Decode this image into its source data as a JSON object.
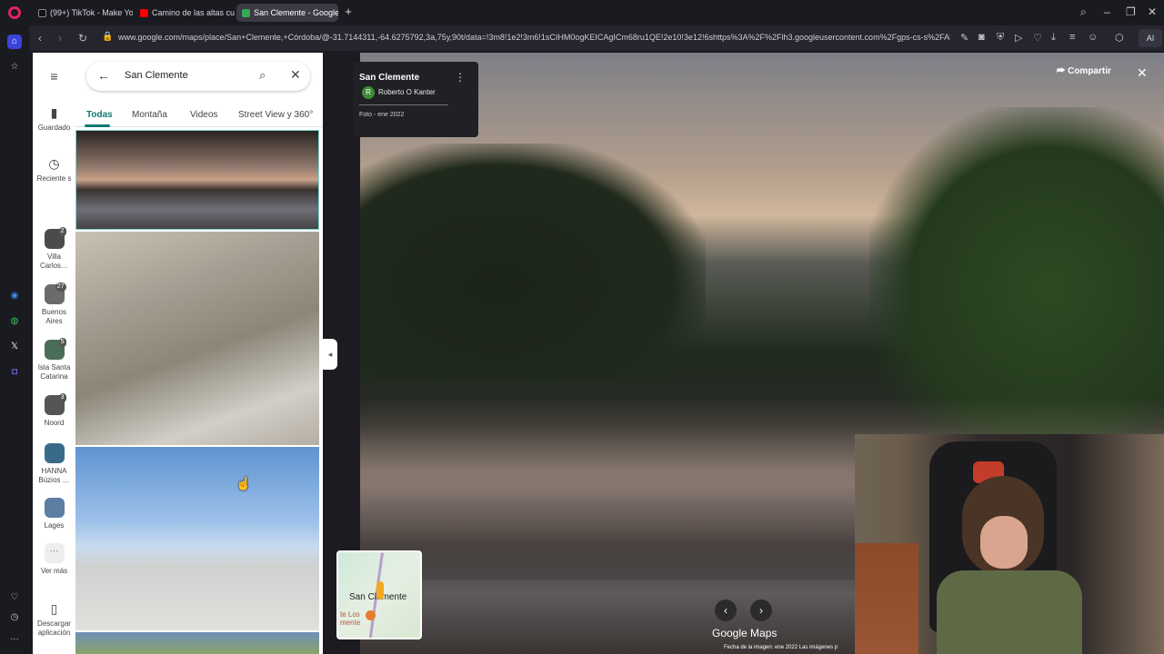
{
  "browser": {
    "tabs": [
      {
        "label": "(99+) TikTok - Make Your D",
        "color": "#111111"
      },
      {
        "label": "Camino de las altas cumb",
        "color": "#ff0000"
      },
      {
        "label": "San Clemente - Google M",
        "color": "#34a853"
      }
    ],
    "url": "www.google.com/maps/place/San+Clemente,+Córdoba/@-31.7144311,-64.6275792,3a,75y,90t/data=!3m8!1e2!3m6!1sCIHM0ogKEICAgICm68ru1QE!2e10!3e12!6shttps%3A%2F%2Flh3.googleusercontent.com%2Fgps-cs-s%2FAHVAweoRNe0pK",
    "ai_label": "AI"
  },
  "rail": {
    "saved": "Guardado",
    "recent": "Reciente s",
    "places": [
      {
        "label": "Villa Carlos…",
        "count": "2"
      },
      {
        "label": "Buenos Aires",
        "count": "27"
      },
      {
        "label": "Isla Santa Catarina",
        "count": "5"
      },
      {
        "label": "Noord",
        "count": "3"
      },
      {
        "label": "HANNA Búzios …",
        "count": ""
      },
      {
        "label": "Lages",
        "count": ""
      }
    ],
    "more": "Ver más",
    "download": "Descargar aplicación"
  },
  "panel": {
    "search_value": "San Clemente",
    "tabs": [
      "Todas",
      "Montaña",
      "Videos",
      "Street View y 360°"
    ]
  },
  "streetview": {
    "place": "San Clemente",
    "author": "Roberto O Kanter",
    "author_initial": "R",
    "photo_date": "Foto - ene 2022",
    "share": "Compartir",
    "minimap_label": "San Clemente",
    "minimap_label2": "te Los\nmente",
    "logo": "Google Maps",
    "footer": "Fecha de la imagen: ene 2022     Las imágenes p"
  }
}
